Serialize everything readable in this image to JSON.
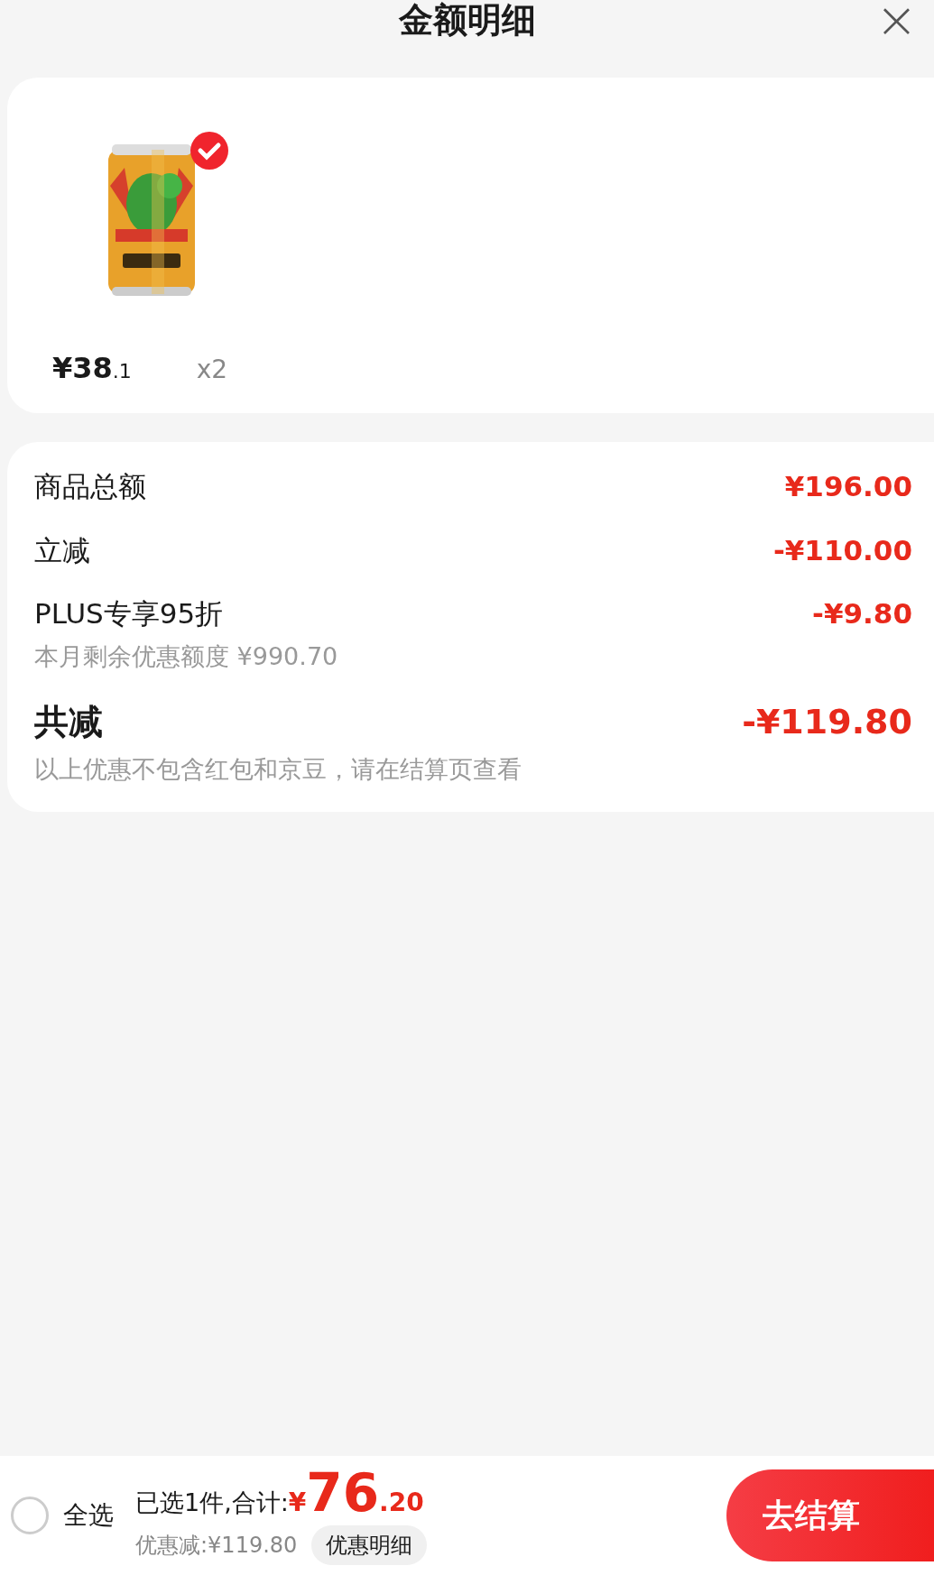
{
  "header": {
    "title": "金额明细",
    "close": "×"
  },
  "items": [
    {
      "price_main": "¥38",
      "price_decimal": ".1",
      "quantity": "x2",
      "selected": true
    }
  ],
  "breakdown": [
    {
      "kind": "row",
      "label": "商品总额",
      "amount": "¥196.00"
    },
    {
      "kind": "row",
      "label": "立减",
      "amount": "-¥110.00"
    },
    {
      "kind": "row",
      "label": "PLUS专享95折",
      "amount": "-¥9.80",
      "note": "本月剩余优惠额度 ¥990.70"
    },
    {
      "kind": "total",
      "label": "共减",
      "amount": "-¥119.80",
      "note": "以上优惠不包含红包和京豆，请在结算页查看"
    }
  ],
  "footer": {
    "select_all": {
      "label": "全选",
      "checked": false
    },
    "summary": "已选1件,合计:",
    "currency": "¥",
    "total_main": "76",
    "total_decimal": ".20",
    "discount": "优惠减:¥119.80",
    "details_button": "优惠明细",
    "checkout_button": "去结算"
  }
}
